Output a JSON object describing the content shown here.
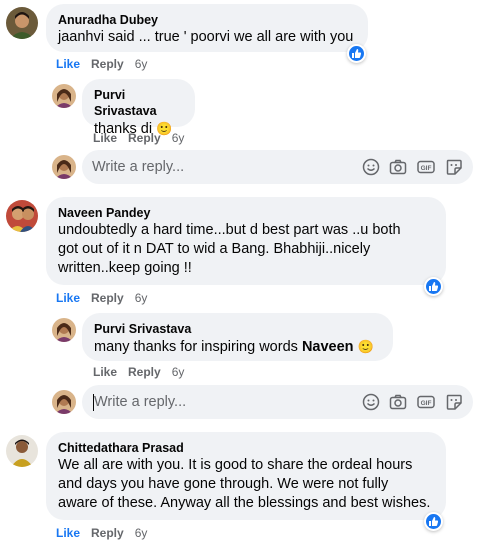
{
  "comments": [
    {
      "author": "Anuradha Dubey",
      "text": "jaanhvi said ... true ' poorvi we all are with you",
      "actions": {
        "like": "Like",
        "reply": "Reply",
        "time": "6y"
      },
      "replies": [
        {
          "author": "Purvi Srivastava",
          "text": "thanks di",
          "emoji": "🙂",
          "actions": {
            "like": "Like",
            "reply": "Reply",
            "time": "6y"
          }
        }
      ]
    },
    {
      "author": "Naveen Pandey",
      "lines": [
        "undoubtedly a hard time...but d best part was ..u both",
        "got out of it n DAT to wid a Bang. Bhabhiji..nicely",
        "written..keep going !!"
      ],
      "actions": {
        "like": "Like",
        "reply": "Reply",
        "time": "6y"
      },
      "replies": [
        {
          "author": "Purvi Srivastava",
          "text": "many thanks for inspiring words",
          "mention": "Naveen",
          "emoji": "🙂",
          "actions": {
            "like": "Like",
            "reply": "Reply",
            "time": "6y"
          }
        }
      ]
    },
    {
      "author": "Chittedathara Prasad",
      "lines": [
        "We all are with you. It is good to share the ordeal hours",
        "and days you have gone through. We were not fully",
        "aware of these. Anyway all the blessings and best wishes."
      ],
      "actions": {
        "like": "Like",
        "reply": "Reply",
        "time": "6y"
      }
    }
  ],
  "reply_box": {
    "placeholder": "Write a reply..."
  },
  "reply_tools": [
    "emoji-icon",
    "camera-icon",
    "gif-icon",
    "sticker-icon"
  ],
  "colors": {
    "bubble": "#f0f2f5",
    "like_blue": "#1877f2",
    "meta_gray": "#65676b"
  }
}
